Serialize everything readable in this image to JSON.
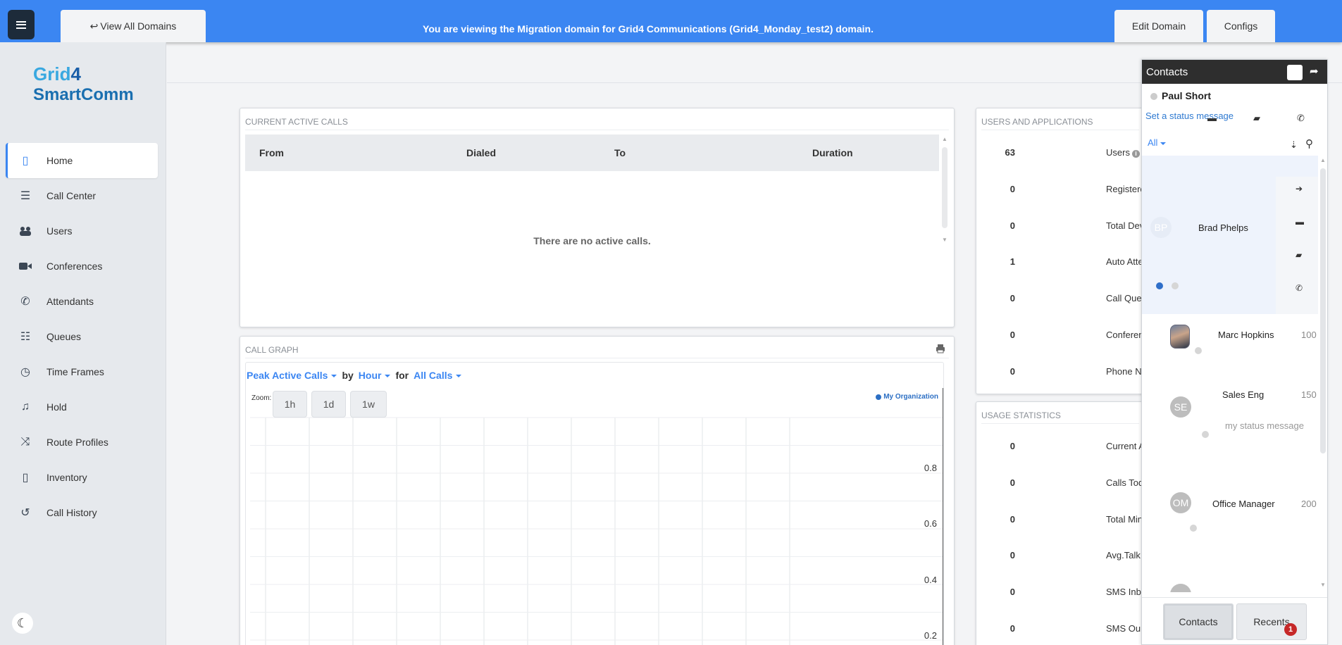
{
  "topbar": {
    "view_all": "View All Domains",
    "banner": "You are viewing the Migration domain for Grid4 Communications (Grid4_Monday_test2) domain.",
    "edit_domain": "Edit Domain",
    "configs": "Configs"
  },
  "logo": {
    "line1a": "Grid",
    "line1b": "4",
    "line2": "SmartComm"
  },
  "nav": [
    {
      "label": "Home",
      "icon": "home-icon"
    },
    {
      "label": "Call Center",
      "icon": "call-center-icon"
    },
    {
      "label": "Users",
      "icon": "users-icon"
    },
    {
      "label": "Conferences",
      "icon": "video-icon"
    },
    {
      "label": "Attendants",
      "icon": "phone-icon"
    },
    {
      "label": "Queues",
      "icon": "list-icon"
    },
    {
      "label": "Time Frames",
      "icon": "clock-icon"
    },
    {
      "label": "Hold",
      "icon": "music-icon"
    },
    {
      "label": "Route Profiles",
      "icon": "shuffle-icon"
    },
    {
      "label": "Inventory",
      "icon": "inventory-icon"
    },
    {
      "label": "Call History",
      "icon": "history-icon"
    }
  ],
  "calls": {
    "title": "Current Active Calls",
    "cols": [
      "From",
      "Dialed",
      "To",
      "Duration"
    ],
    "empty": "There are no active calls."
  },
  "graph": {
    "title": "Call Graph",
    "metric": "Peak Active Calls",
    "by": "by",
    "period": "Hour",
    "for": "for",
    "scope": "All Calls",
    "zoom_label": "Zoom:",
    "zoom": [
      "1h",
      "1d",
      "1w"
    ],
    "legend": "My Organization",
    "yticks": [
      "0.8",
      "0.6",
      "0.4",
      "0.2"
    ]
  },
  "users_apps": {
    "title": "Users and Applications",
    "rows": [
      {
        "value": "63",
        "name": "Users"
      },
      {
        "value": "0",
        "name": "Registere"
      },
      {
        "value": "0",
        "name": "Total Dev"
      },
      {
        "value": "1",
        "name": "Auto Atte"
      },
      {
        "value": "0",
        "name": "Call Que"
      },
      {
        "value": "0",
        "name": "Conferen"
      },
      {
        "value": "0",
        "name": "Phone N"
      }
    ]
  },
  "usage": {
    "title": "Usage Statistics",
    "rows": [
      {
        "value": "0",
        "name": "Current A"
      },
      {
        "value": "0",
        "name": "Calls Tod"
      },
      {
        "value": "0",
        "name": "Total Min"
      },
      {
        "value": "0",
        "name": "Avg.Talk"
      },
      {
        "value": "0",
        "name": "SMS Inb"
      },
      {
        "value": "0",
        "name": "SMS Ou"
      }
    ]
  },
  "dock": {
    "title": "Contacts",
    "me": "Paul Short",
    "status_link": "Set a status message",
    "filter": "All",
    "contacts": [
      {
        "initials": "BP",
        "name": "Brad Phelps",
        "ext": ""
      },
      {
        "initials": "",
        "name": "Marc Hopkins",
        "ext": "100"
      },
      {
        "initials": "SE",
        "name": "Sales Eng",
        "ext": "150",
        "status": "my status message"
      },
      {
        "initials": "OM",
        "name": "Office Manager",
        "ext": "200"
      }
    ],
    "tabs": [
      "Contacts",
      "Recents"
    ],
    "recents_badge": "1"
  }
}
